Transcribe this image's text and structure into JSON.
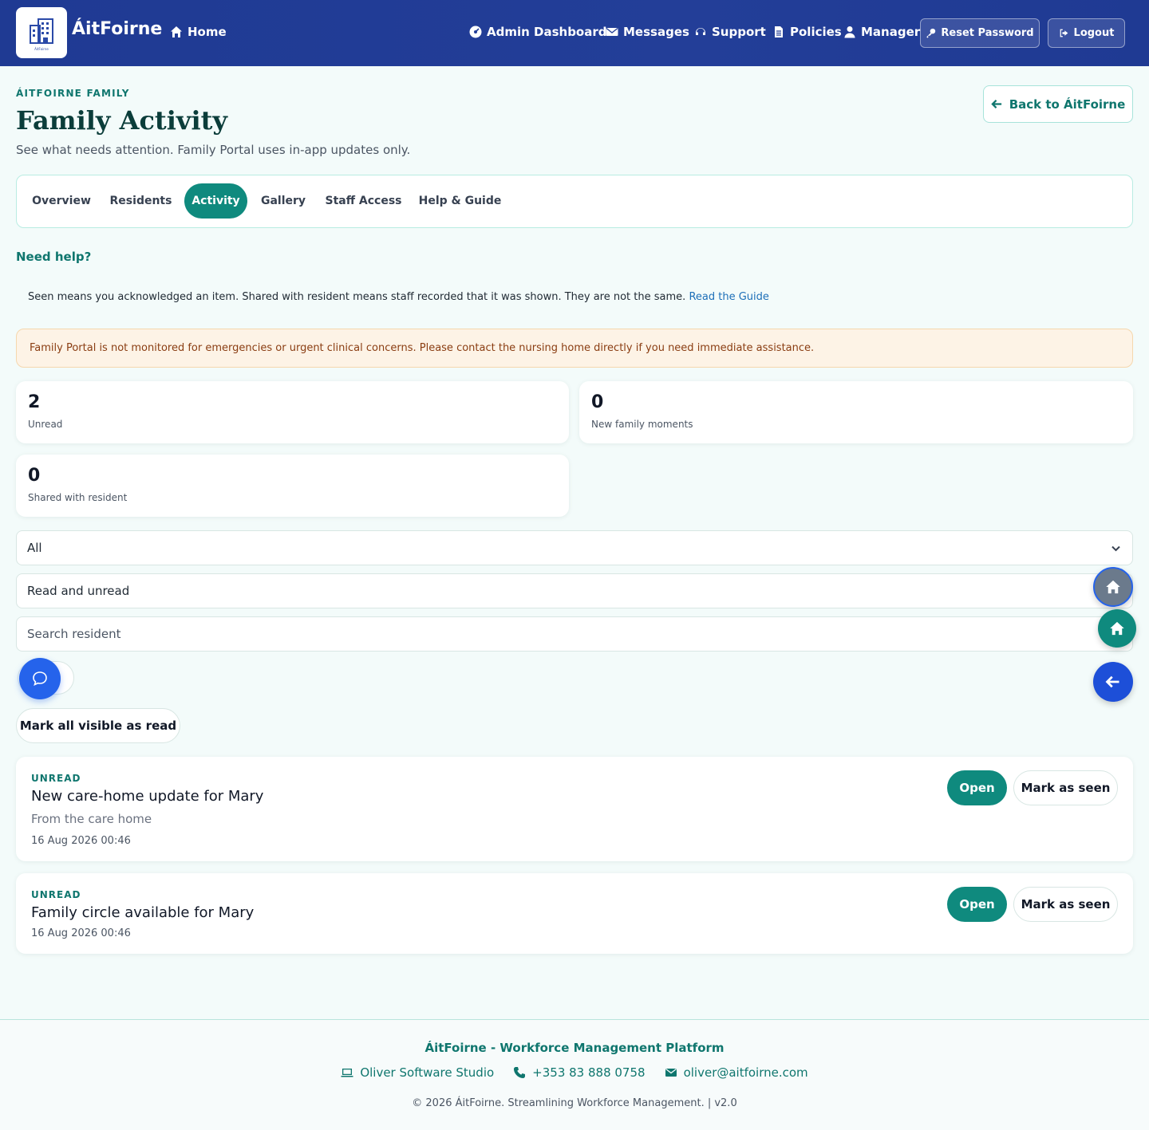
{
  "navbar": {
    "brand": "ÁitFoirne",
    "logo_caption": "ÁitFoirne",
    "home": "Home",
    "admin_dashboard": "Admin Dashboard",
    "messages": "Messages",
    "support": "Support",
    "policies": "Policies",
    "manager": "Manager",
    "reset_password": "Reset Password",
    "logout": "Logout"
  },
  "header": {
    "eyebrow": "ÁITFOIRNE FAMILY",
    "title": "Family Activity",
    "subtitle": "See what needs attention. Family Portal uses in-app updates only.",
    "back_button": "Back to ÁitFoirne"
  },
  "tabs": [
    {
      "label": "Overview",
      "active": false
    },
    {
      "label": "Residents",
      "active": false
    },
    {
      "label": "Activity",
      "active": true
    },
    {
      "label": "Gallery",
      "active": false
    },
    {
      "label": "Staff Access",
      "active": false
    },
    {
      "label": "Help & Guide",
      "active": false
    }
  ],
  "help": {
    "title": "Need help?",
    "text": "Seen means you acknowledged an item. Shared with resident means staff recorded that it was shown. They are not the same.",
    "link": "Read the Guide"
  },
  "alert": "Family Portal is not monitored for emergencies or urgent clinical concerns. Please contact the nursing home directly if you need immediate assistance.",
  "stats": {
    "unread": {
      "value": "2",
      "label": "Unread"
    },
    "moments": {
      "value": "0",
      "label": "New family moments"
    },
    "shared": {
      "value": "0",
      "label": "Shared with resident"
    }
  },
  "filters": {
    "type_value": "All",
    "read_value": "Read and unread",
    "search_placeholder": "Search resident"
  },
  "mark_all": "Mark all visible as read",
  "items": [
    {
      "tag": "UNREAD",
      "title": "New care-home update for Mary",
      "from": "From the care home",
      "time": "16 Aug 2026 00:46",
      "open": "Open",
      "seen": "Mark as seen"
    },
    {
      "tag": "UNREAD",
      "title": "Family circle available for Mary",
      "time": "16 Aug 2026 00:46",
      "open": "Open",
      "seen": "Mark as seen"
    }
  ],
  "footer": {
    "title": "ÁitFoirne - Workforce Management Platform",
    "studio": "Oliver Software Studio",
    "phone": "+353 83 888 0758",
    "email": "oliver@aitfoirne.com",
    "copyright": "© 2026 ÁitFoirne. Streamlining Workforce Management. | v2.0"
  },
  "colors": {
    "navbar": "#1f3a93",
    "accent": "#0f8a7e",
    "alert_bg": "#fdf3e6",
    "chat_fab": "#2563eb"
  }
}
